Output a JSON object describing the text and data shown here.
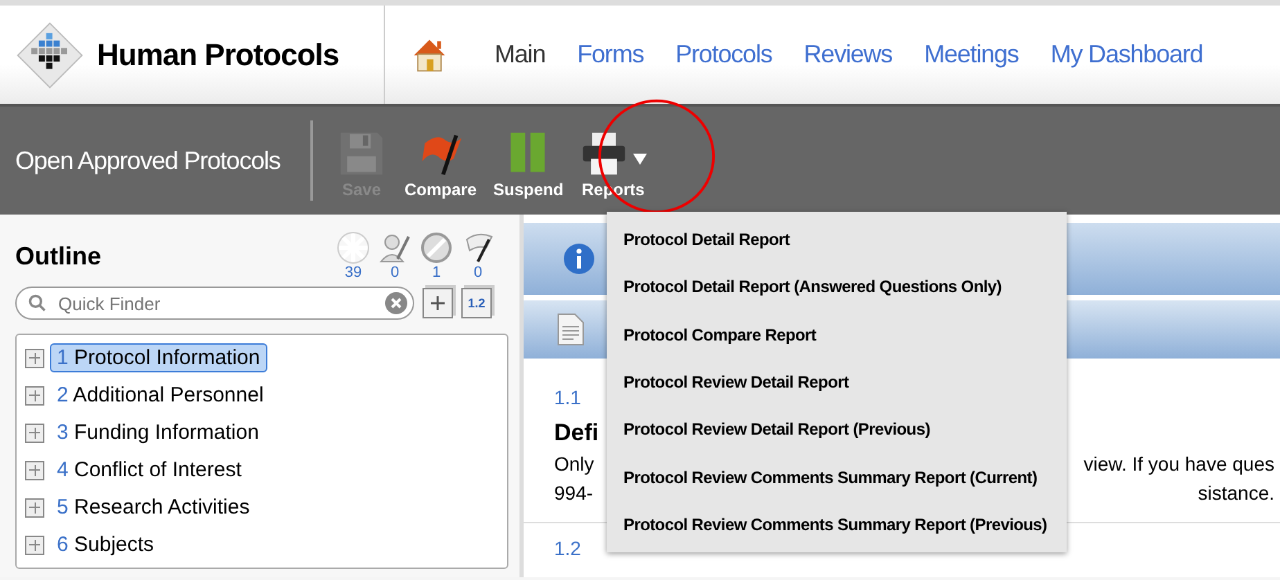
{
  "app": {
    "title": "Human Protocols"
  },
  "nav": [
    {
      "label": "Main",
      "selected": true
    },
    {
      "label": "Forms",
      "selected": false
    },
    {
      "label": "Protocols",
      "selected": false
    },
    {
      "label": "Reviews",
      "selected": false
    },
    {
      "label": "Meetings",
      "selected": false
    },
    {
      "label": "My Dashboard",
      "selected": false
    }
  ],
  "toolbar": {
    "title": "Open Approved Protocols",
    "buttons": [
      {
        "kind": "save",
        "label": "Save",
        "disabled": true
      },
      {
        "kind": "compare",
        "label": "Compare",
        "disabled": false
      },
      {
        "kind": "suspend",
        "label": "Suspend",
        "disabled": false
      },
      {
        "kind": "reports",
        "label": "Reports",
        "disabled": false
      }
    ]
  },
  "reports_menu": {
    "items": [
      "Protocol Detail Report",
      "Protocol Detail Report (Answered Questions Only)",
      "Protocol Compare Report",
      "Protocol Review Detail Report",
      "Protocol Review Detail Report (Previous)",
      "Protocol Review Comments Summary Report (Current)",
      "Protocol Review Comments Summary Report (Previous)"
    ]
  },
  "outline": {
    "title": "Outline",
    "counters": [
      {
        "kind": "burst",
        "count": "39"
      },
      {
        "kind": "person",
        "count": "0"
      },
      {
        "kind": "blocked",
        "count": "1"
      },
      {
        "kind": "flag",
        "count": "0"
      }
    ],
    "search": {
      "placeholder": "Quick Finder"
    },
    "number_button": "1.2",
    "items": [
      {
        "number": "1",
        "label": "Protocol Information",
        "selected": true
      },
      {
        "number": "2",
        "label": "Additional Personnel",
        "selected": false
      },
      {
        "number": "3",
        "label": "Funding Information",
        "selected": false
      },
      {
        "number": "4",
        "label": "Conflict of Interest",
        "selected": false
      },
      {
        "number": "5",
        "label": "Research Activities",
        "selected": false
      },
      {
        "number": "6",
        "label": "Subjects",
        "selected": false
      }
    ]
  },
  "content": {
    "section_number": "1.1",
    "heading": "Defi",
    "text_fragments": [
      [
        "Only",
        "view. If you have ques"
      ],
      [
        "994-",
        "sistance."
      ]
    ],
    "next_section_number": "1.2"
  }
}
